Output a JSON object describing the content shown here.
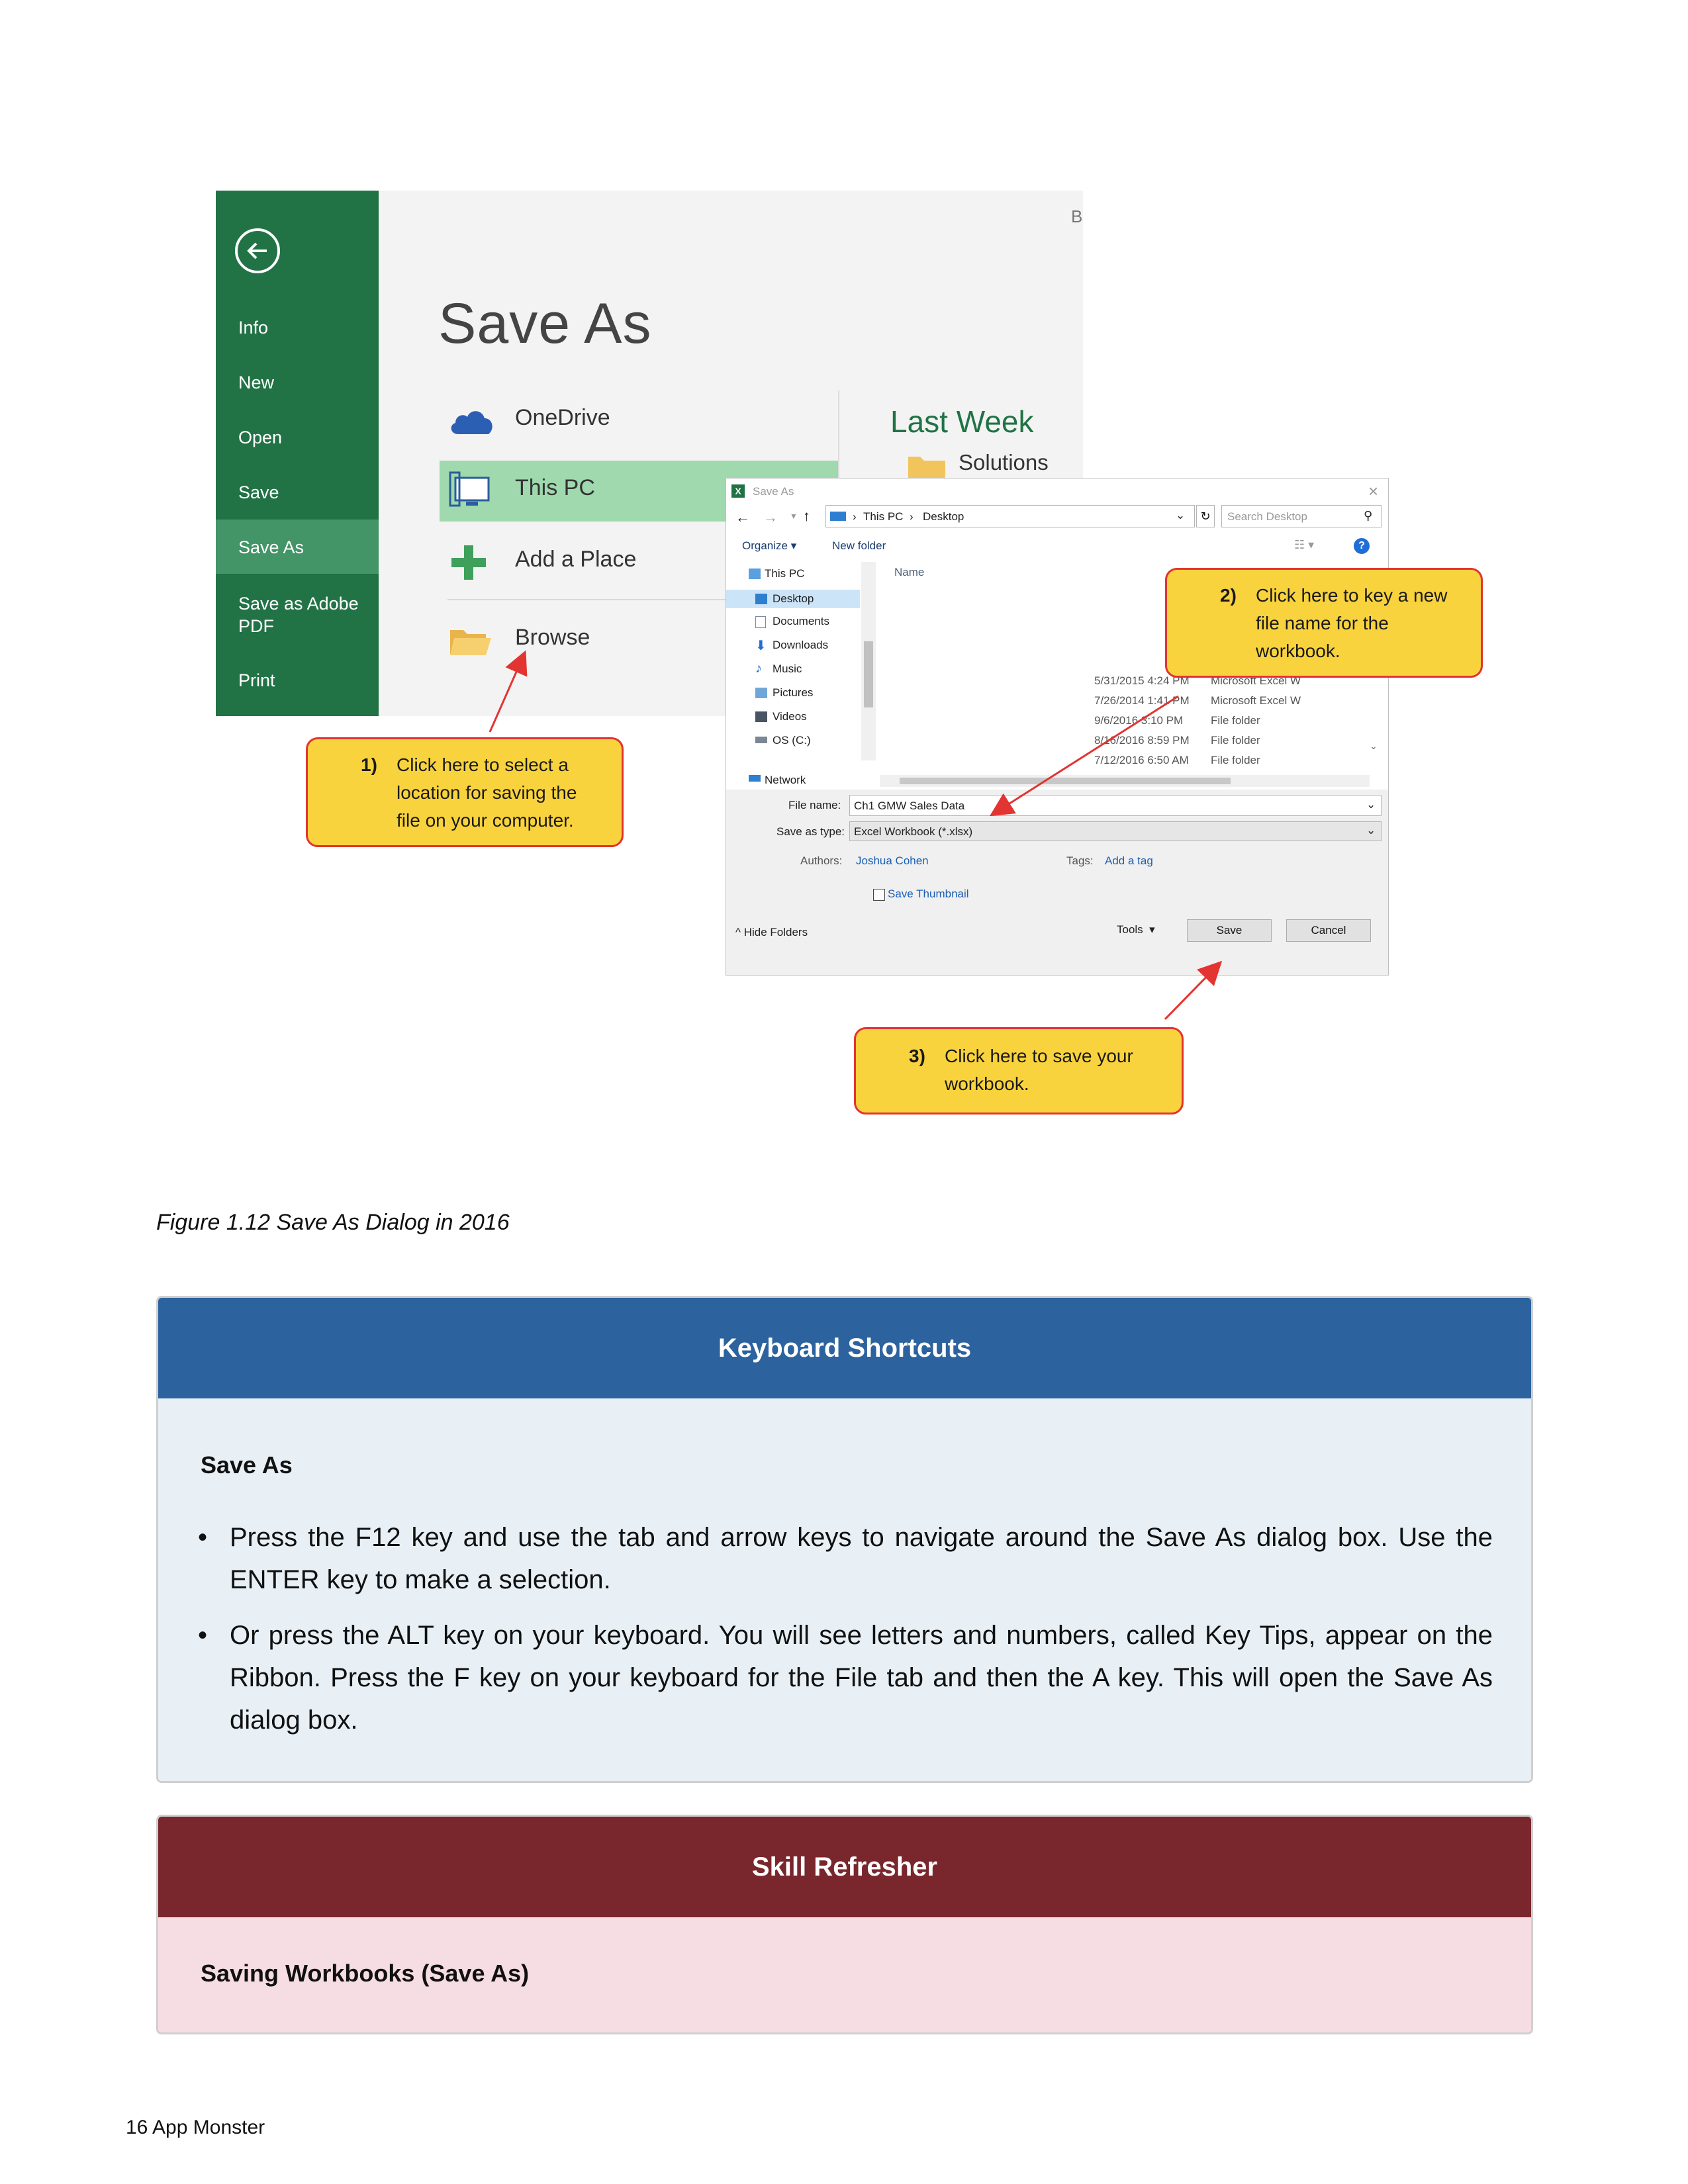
{
  "backstage": {
    "title": "Save As",
    "corner_letter": "B",
    "nav_items": [
      "Info",
      "New",
      "Open",
      "Save",
      "Save As",
      "Save as Adobe PDF",
      "Print"
    ],
    "selected_nav": "Save As",
    "locations": [
      "OneDrive",
      "This PC",
      "Add a Place",
      "Browse"
    ],
    "selected_location": "This PC",
    "recent_heading": "Last Week",
    "recent_folder": "Solutions"
  },
  "dialog": {
    "title": "Save As",
    "breadcrumb": [
      "This PC",
      "Desktop"
    ],
    "search_placeholder": "Search Desktop",
    "toolbar": {
      "organize": "Organize",
      "new_folder": "New folder"
    },
    "tree": [
      "This PC",
      "Desktop",
      "Documents",
      "Downloads",
      "Music",
      "Pictures",
      "Videos",
      "OS (C:)",
      "Network"
    ],
    "column_name": "Name",
    "rows": [
      {
        "date": "5/31/2015 4:24 PM",
        "type": "Microsoft Excel W"
      },
      {
        "date": "7/26/2014 1:41 PM",
        "type": "Microsoft Excel W"
      },
      {
        "date": "9/6/2016 3:10 PM",
        "type": "File folder"
      },
      {
        "date": "8/16/2016 8:59 PM",
        "type": "File folder"
      },
      {
        "date": "7/12/2016 6:50 AM",
        "type": "File folder"
      }
    ],
    "file_name_label": "File name:",
    "file_name_value": "Ch1 GMW Sales Data",
    "save_type_label": "Save as type:",
    "save_type_value": "Excel Workbook (*.xlsx)",
    "authors_label": "Authors:",
    "authors_value": "Joshua Cohen",
    "tags_label": "Tags:",
    "tags_value": "Add a tag",
    "thumbnail_label": "Save Thumbnail",
    "hide_folders": "Hide Folders",
    "tools": "Tools",
    "save_button": "Save",
    "cancel_button": "Cancel"
  },
  "callouts": [
    {
      "num": "1)",
      "lines": [
        "Click here to select a",
        "location for saving the",
        "file on your computer."
      ]
    },
    {
      "num": "2)",
      "lines": [
        "Click here to key a new",
        "file name for the",
        "workbook."
      ]
    },
    {
      "num": "3)",
      "lines": [
        "Click here to save your",
        "workbook."
      ]
    }
  ],
  "caption": "Figure 1.12 Save As Dialog in 2016",
  "keyboard_box": {
    "header": "Keyboard Shortcuts",
    "subtitle": "Save As",
    "bullets": [
      "Press the F12 key and use the tab and arrow keys to navigate around the Save As dialog box. Use the ENTER key to make a selection.",
      "Or press the ALT key on your keyboard. You will see letters and numbers, called Key Tips, appear on the Ribbon. Press the F key on your keyboard for the File tab and then the A key. This will open the Save As dialog box."
    ],
    "header_color": "#2c629e",
    "body_color": "#e8f0f6"
  },
  "skill_box": {
    "header": "Skill Refresher",
    "subtitle": "Saving Workbooks (Save As)",
    "header_color": "#79262d",
    "body_color": "#f6dde3"
  },
  "footer": "16 App Monster"
}
